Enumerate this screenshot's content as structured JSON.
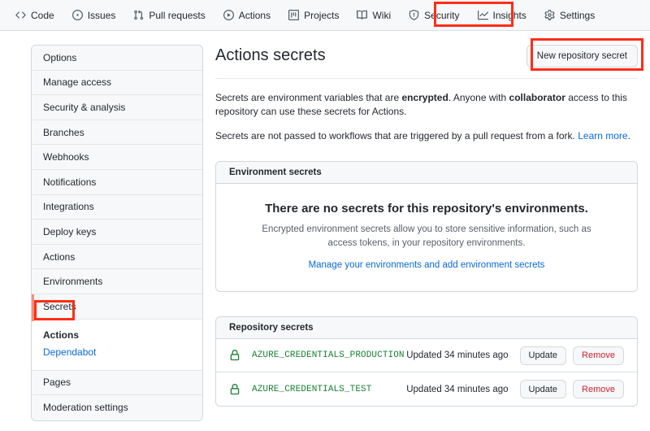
{
  "repo_nav": {
    "items": [
      {
        "label": "Code",
        "icon": "code-icon",
        "selected": false
      },
      {
        "label": "Issues",
        "icon": "issue-opened-icon",
        "selected": false
      },
      {
        "label": "Pull requests",
        "icon": "git-pull-request-icon",
        "selected": false
      },
      {
        "label": "Actions",
        "icon": "play-icon",
        "selected": false
      },
      {
        "label": "Projects",
        "icon": "project-icon",
        "selected": false
      },
      {
        "label": "Wiki",
        "icon": "book-icon",
        "selected": false
      },
      {
        "label": "Security",
        "icon": "shield-icon",
        "selected": false
      },
      {
        "label": "Insights",
        "icon": "graph-icon",
        "selected": false
      },
      {
        "label": "Settings",
        "icon": "gear-icon",
        "selected": true
      }
    ]
  },
  "sidebar": {
    "items": [
      {
        "label": "Options"
      },
      {
        "label": "Manage access"
      },
      {
        "label": "Security & analysis"
      },
      {
        "label": "Branches"
      },
      {
        "label": "Webhooks"
      },
      {
        "label": "Notifications"
      },
      {
        "label": "Integrations"
      },
      {
        "label": "Deploy keys"
      },
      {
        "label": "Actions"
      },
      {
        "label": "Environments"
      },
      {
        "label": "Secrets"
      }
    ],
    "secrets_sub": [
      {
        "label": "Actions",
        "current": true
      },
      {
        "label": "Dependabot",
        "current": false
      }
    ],
    "items_after": [
      {
        "label": "Pages"
      },
      {
        "label": "Moderation settings"
      }
    ]
  },
  "main": {
    "title": "Actions secrets",
    "new_secret_button": "New repository secret",
    "description_1": {
      "part1": "Secrets are environment variables that are ",
      "bold1": "encrypted",
      "part2": ". Anyone with ",
      "bold2": "collaborator",
      "part3": " access to this repository can use these secrets for Actions."
    },
    "description_2": {
      "text": "Secrets are not passed to workflows that are triggered by a pull request from a fork. ",
      "link": "Learn more",
      "tail": "."
    },
    "environment_secrets": {
      "header": "Environment secrets",
      "blank_title": "There are no secrets for this repository's environments.",
      "blank_text": "Encrypted environment secrets allow you to store sensitive information, such as access tokens, in your repository environments.",
      "blank_link": "Manage your environments and add environment secrets"
    },
    "repository_secrets": {
      "header": "Repository secrets",
      "rows": [
        {
          "icon": "lock-icon",
          "name": "AZURE_CREDENTIALS_PRODUCTION",
          "updated": "Updated 34 minutes ago",
          "update_label": "Update",
          "remove_label": "Remove"
        },
        {
          "icon": "lock-icon",
          "name": "AZURE_CREDENTIALS_TEST",
          "updated": "Updated 34 minutes ago",
          "update_label": "Update",
          "remove_label": "Remove"
        }
      ]
    }
  },
  "annotations": [
    {
      "name": "settings-tab-highlight",
      "color": "#ff2d16"
    },
    {
      "name": "new-repository-secret-highlight",
      "color": "#ff2d16"
    },
    {
      "name": "secrets-sidebar-highlight",
      "color": "#ff2d16"
    }
  ],
  "colors": {
    "accent_link": "#0969da",
    "secret_green": "#1a7f37",
    "danger_red": "#cf222e",
    "annotation_red": "#ff2d16",
    "selected_marker": "#fd8c73"
  }
}
